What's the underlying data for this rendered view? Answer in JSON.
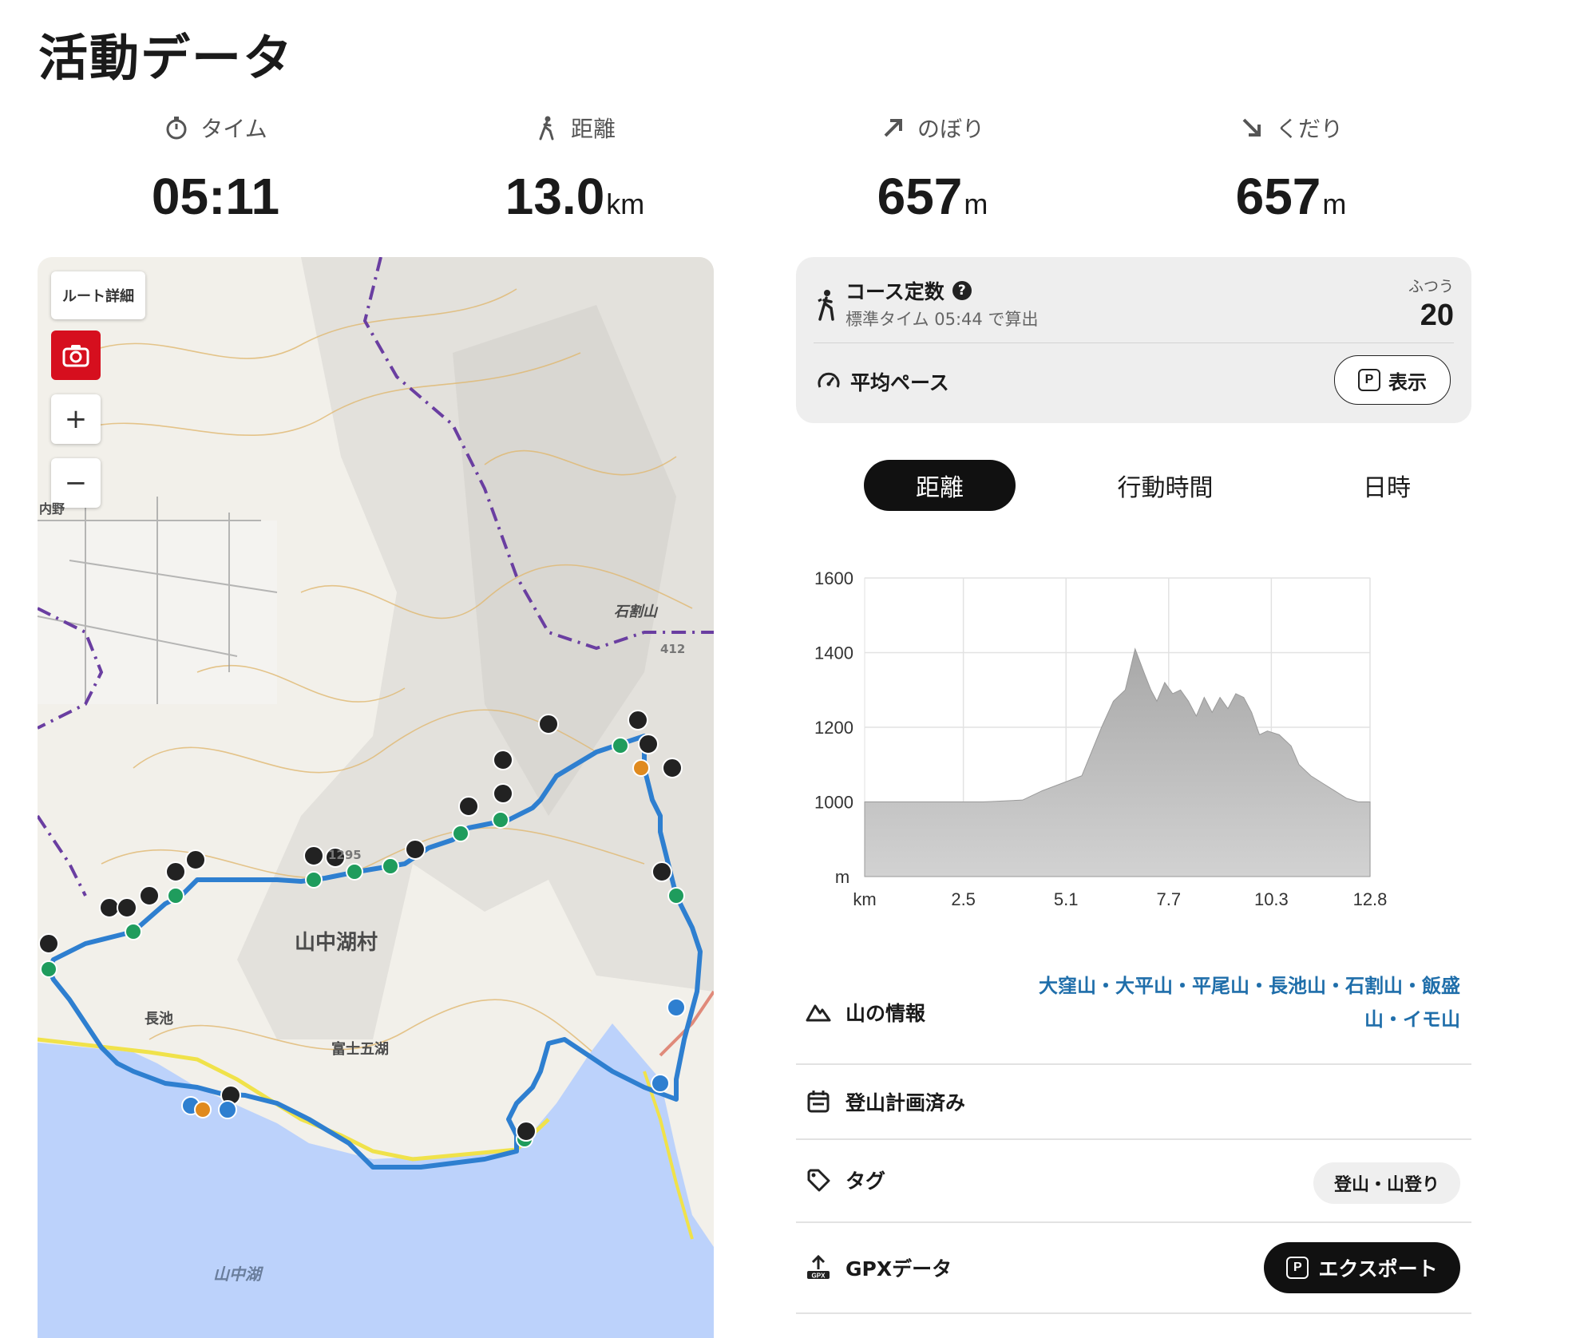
{
  "page": {
    "title": "活動データ"
  },
  "stats": [
    {
      "label": "タイム",
      "icon": "stopwatch-icon",
      "value": "05:11",
      "unit": ""
    },
    {
      "label": "距離",
      "icon": "walker-icon",
      "value": "13.0",
      "unit": "km"
    },
    {
      "label": "のぼり",
      "icon": "arrow-up-right-icon",
      "value": "657",
      "unit": "m"
    },
    {
      "label": "くだり",
      "icon": "arrow-down-right-icon",
      "value": "657",
      "unit": "m"
    }
  ],
  "map": {
    "route_detail_label": "ルート詳細",
    "zoom_in": "+",
    "zoom_out": "−",
    "labels": {
      "village": "山中湖村",
      "lake": "山中湖",
      "peak": "石割山",
      "peak_elev": "412",
      "elev2": "1295",
      "place1": "長池",
      "place2": "富士五湖",
      "place3": "内野"
    },
    "route_color": "#2e7fd0",
    "water_color": "#bcd2fb"
  },
  "course": {
    "title": "コース定数",
    "subtitle": "標準タイム 05:44 で算出",
    "level": "ふつう",
    "value": "20",
    "pace_label": "平均ペース",
    "show_button": "表示",
    "premium_badge": "P"
  },
  "tabs": [
    "距離",
    "行動時間",
    "日時"
  ],
  "chart_data": {
    "type": "area",
    "x": [
      0,
      0.4,
      1.0,
      2.0,
      3.0,
      4.0,
      4.5,
      5.0,
      5.5,
      6.0,
      6.3,
      6.6,
      6.85,
      7.1,
      7.25,
      7.4,
      7.6,
      7.8,
      8.0,
      8.2,
      8.4,
      8.6,
      8.8,
      9.0,
      9.2,
      9.4,
      9.6,
      9.8,
      10.0,
      10.2,
      10.5,
      10.8,
      11.0,
      11.3,
      11.6,
      11.9,
      12.2,
      12.5,
      12.8
    ],
    "y": [
      1000,
      1000,
      1000,
      1000,
      1000,
      1005,
      1030,
      1050,
      1070,
      1200,
      1270,
      1300,
      1410,
      1340,
      1300,
      1270,
      1320,
      1290,
      1300,
      1270,
      1230,
      1280,
      1240,
      1280,
      1250,
      1290,
      1280,
      1240,
      1180,
      1190,
      1180,
      1150,
      1100,
      1070,
      1050,
      1030,
      1010,
      1000,
      1000
    ],
    "xlabel": "km",
    "ylabel": "m",
    "xticks": [
      "2.5",
      "5.1",
      "7.7",
      "10.3",
      "12.8"
    ],
    "yticks": [
      "1000",
      "1200",
      "1400",
      "1600"
    ],
    "xlim": [
      0,
      12.8
    ],
    "ylim": [
      800,
      1600
    ],
    "fill_color": "#b9b9b9",
    "grid": true
  },
  "info": {
    "mountain_label": "山の情報",
    "mountains": "大窪山・大平山・平尾山・長池山・石割山・飯盛山・イモ山",
    "plan_label": "登山計画済み",
    "tag_label": "タグ",
    "tag_value": "登山・山登り",
    "gpx_label": "GPXデータ",
    "export_label": "エクスポート"
  }
}
